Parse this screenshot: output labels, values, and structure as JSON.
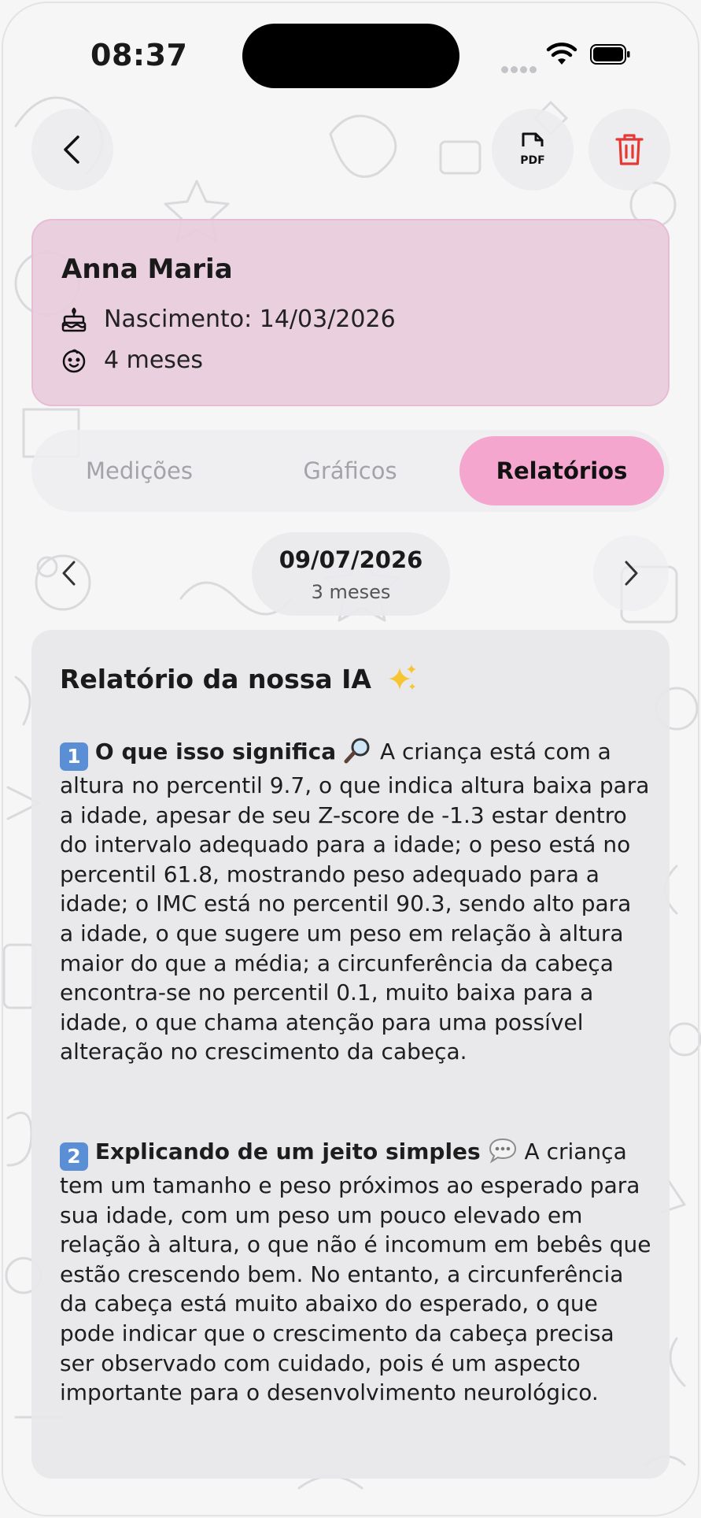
{
  "status_bar": {
    "time": "08:37"
  },
  "header": {
    "pdf_label": "PDF"
  },
  "profile": {
    "name": "Anna Maria",
    "birth": "Nascimento: 14/03/2026",
    "age": "4 meses"
  },
  "tabs": [
    {
      "label": "Medições",
      "active": false
    },
    {
      "label": "Gráficos",
      "active": false
    },
    {
      "label": "Relatórios",
      "active": true
    }
  ],
  "date_nav": {
    "date": "09/07/2026",
    "age": "3 meses"
  },
  "report": {
    "title": "Relatório da nossa IA",
    "sections": [
      {
        "number": "1",
        "heading": "O que isso significa",
        "icon": "magnifier-icon",
        "text": "A criança está com a altura no percentil 9.7, o que indica altura baixa para a idade, apesar de seu Z-score de -1.3 estar dentro do intervalo adequado para a idade; o peso está no percentil 61.8, mostrando peso adequado para a idade; o IMC está no percentil 90.3, sendo alto para a idade, o que sugere um peso em relação à altura maior do que a média; a circunferência da cabeça encontra-se no percentil 0.1, muito baixa para a idade, o que chama atenção para uma possível alteração no crescimento da cabeça."
      },
      {
        "number": "2",
        "heading": "Explicando de um jeito simples",
        "icon": "speech-bubble-icon",
        "text": "A criança tem um tamanho e peso próximos ao esperado para sua idade, com um peso um pouco elevado em relação à altura, o que não é incomum em bebês que estão crescendo bem. No entanto, a circunferência da cabeça está muito abaixo do esperado, o que pode indicar que o crescimento da cabeça precisa ser observado com cuidado, pois é um aspecto importante para o desenvolvimento neurológico."
      }
    ]
  },
  "colors": {
    "profile_bg": "#e8cbdb",
    "active_tab": "#f4a6cf",
    "delete_red": "#e53935",
    "badge_blue": "#5a8fd6"
  }
}
